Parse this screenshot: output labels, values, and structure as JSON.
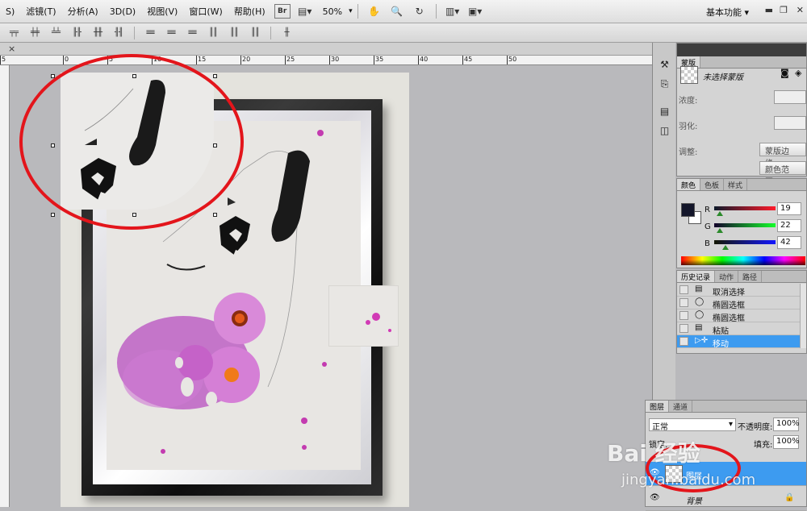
{
  "menubar": {
    "items": [
      "S)",
      "滤镜(T)",
      "分析(A)",
      "3D(D)",
      "视图(V)",
      "窗口(W)",
      "帮助(H)"
    ],
    "zoom": "50%",
    "workspace": "基本功能"
  },
  "doctab": {
    "close": "×"
  },
  "ruler": {
    "top_ticks": [
      "5",
      "0",
      "5",
      "10",
      "15",
      "20",
      "25",
      "30",
      "35",
      "40",
      "45",
      "50"
    ]
  },
  "mask_panel": {
    "tab": "蒙版",
    "status": "未选择蒙版",
    "density_label": "浓度:",
    "feather_label": "羽化:",
    "adjust_label": "调整:",
    "mask_edge_button": "蒙版边缘...",
    "color_range_button": "颜色范围..."
  },
  "color_panel": {
    "tabs": [
      "颜色",
      "色板",
      "样式"
    ],
    "r_label": "R",
    "g_label": "G",
    "b_label": "B",
    "r": 19,
    "g": 22,
    "b": 42,
    "foreground": "#13162a"
  },
  "history_panel": {
    "tabs": [
      "历史记录",
      "动作",
      "路径"
    ],
    "items": [
      {
        "label": "取消选择",
        "icon": "doc-icon"
      },
      {
        "label": "椭圆选框",
        "icon": "ellipse-icon"
      },
      {
        "label": "椭圆选框",
        "icon": "ellipse-icon"
      },
      {
        "label": "粘贴",
        "icon": "doc-icon"
      },
      {
        "label": "移动",
        "icon": "move-icon"
      }
    ]
  },
  "layers_panel": {
    "tabs": [
      "图层",
      "通道"
    ],
    "blend_mode": "正常",
    "opacity_label": "不透明度:",
    "opacity": "100%",
    "lock_label": "锁定:",
    "fill_label": "填充:",
    "fill": "100%",
    "layers": [
      {
        "name": "图层",
        "selected": true
      },
      {
        "name": "背景",
        "selected": false
      }
    ]
  },
  "watermark": {
    "main": "Bai 经验",
    "sub": "jingyan.baidu.com"
  },
  "colors": {
    "accent_red": "#e3151b",
    "selection_blue": "#3d9bf0",
    "magenta": "#b03cb8"
  }
}
